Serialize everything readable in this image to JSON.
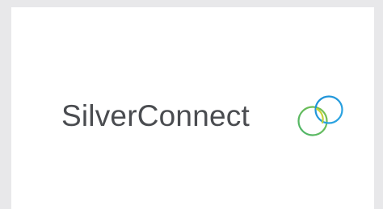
{
  "brand": {
    "name": "SilverConnect",
    "logo_icon": "overlapping-rings-icon",
    "colors": {
      "text": "#4a4c50",
      "ring_blue": "#1b8fd6",
      "ring_green": "#7cc24e",
      "ring_yellow": "#c7d23a",
      "background_outer": "#e8e8ea",
      "background_card": "#ffffff"
    }
  }
}
